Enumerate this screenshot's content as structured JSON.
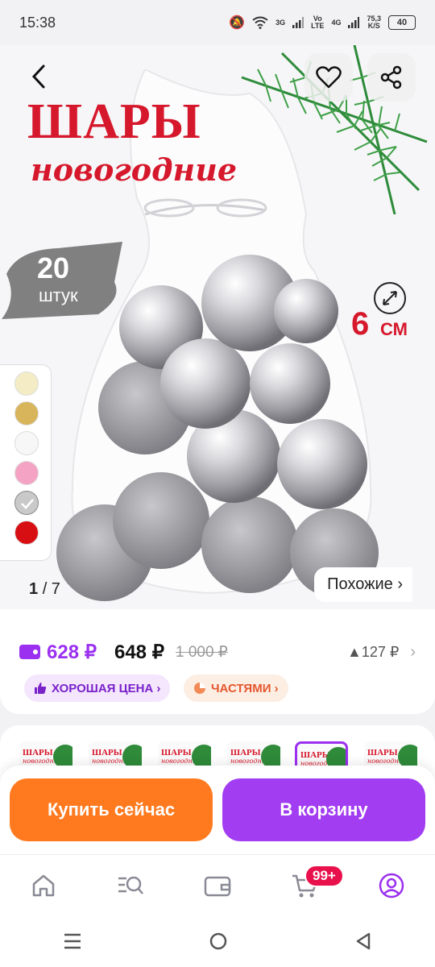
{
  "status_bar": {
    "time": "15:38",
    "net_3g": "3G",
    "volte_top": "Vo",
    "volte_bottom": "LTE",
    "net_4g": "4G",
    "speed_value": "75,3",
    "speed_unit": "K/S",
    "battery": "40"
  },
  "product_image": {
    "title": "ШАРЫ",
    "subtitle": "новогодние",
    "count_number": "20",
    "count_word": "штук",
    "size_number": "6",
    "size_unit": "СМ",
    "swatch_colors": [
      "#f3ecc4",
      "#d8b45a",
      "#f7f7f7",
      "#f4a3c4",
      "#c9c9c9",
      "#d80f12"
    ],
    "selected_swatch": 4,
    "pager_current": "1",
    "pager_total": "/ 7",
    "similar_label": "Похожие ›"
  },
  "price": {
    "wallet_price": "628 ₽",
    "price": "648 ₽",
    "old_price": "1 000 ₽",
    "drop": "▲127 ₽",
    "chip_good": "ХОРОШАЯ ЦЕНА ›",
    "chip_parts": "ЧАСТЯМИ ›"
  },
  "variants": {
    "thumb_title": "ШАРЫ",
    "thumb_subtitle": "новогодние",
    "selected_index": 4
  },
  "actions": {
    "buy_now": "Купить сейчас",
    "to_cart": "В корзину"
  },
  "bottom_nav": {
    "cart_badge": "99+"
  },
  "colors": {
    "accent_purple": "#9b30f0",
    "buy_orange": "#ff7a1f",
    "cart_purple": "#a23df2",
    "brand_red": "#d6182c"
  }
}
